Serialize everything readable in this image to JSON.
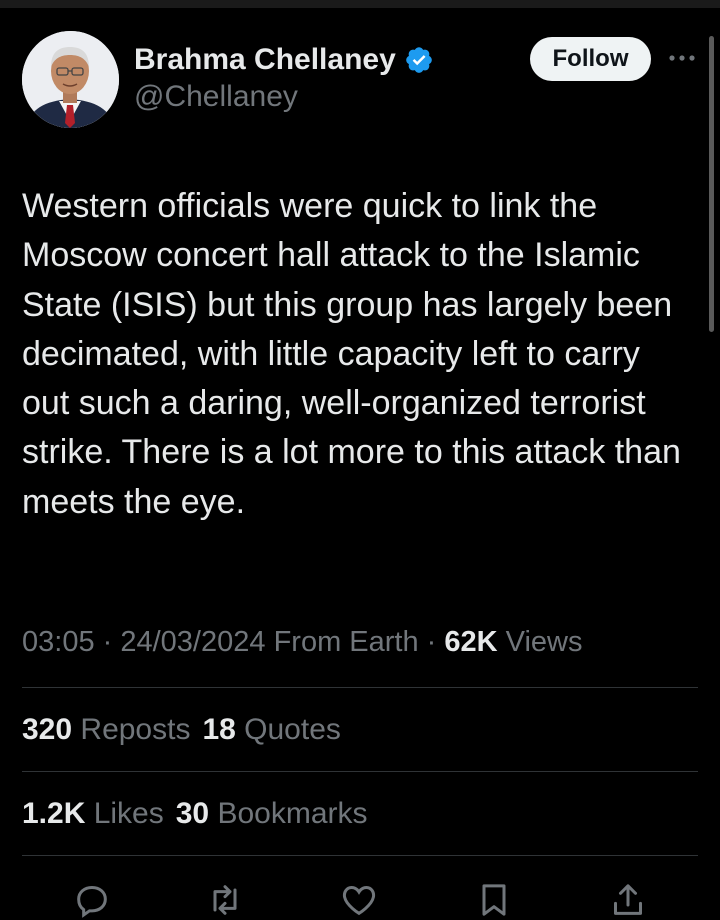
{
  "author": {
    "name": "Brahma Chellaney",
    "handle": "@Chellaney"
  },
  "follow_label": "Follow",
  "tweet_text": "Western officials were quick to link the Moscow concert hall attack to the Islamic State (ISIS) but this group has largely been decimated, with little capacity left to carry out such a daring, well-organized terrorist strike. There is a lot more to this attack than meets the eye.",
  "meta": {
    "time": "03:05",
    "sep1": " · ",
    "date": "24/03/2024",
    "source": " From Earth",
    "sep2": " · ",
    "views_count": "62K",
    "views_label": " Views"
  },
  "stats": {
    "reposts_count": "320",
    "reposts_label": " Reposts",
    "quotes_count": "18",
    "quotes_label": " Quotes",
    "likes_count": "1.2K",
    "likes_label": " Likes",
    "bookmarks_count": "30",
    "bookmarks_label": " Bookmarks"
  },
  "icons": {
    "verified": "verified-badge-icon",
    "more": "more-dots-icon",
    "reply": "reply-icon",
    "repost": "repost-icon",
    "like": "like-icon",
    "bookmark": "bookmark-icon",
    "share": "share-icon"
  },
  "colors": {
    "background": "#000000",
    "text_primary": "#e7e9ea",
    "text_secondary": "#71767b",
    "verified_blue": "#1d9bf0",
    "divider": "#2f3336",
    "follow_bg": "#eff3f4"
  }
}
